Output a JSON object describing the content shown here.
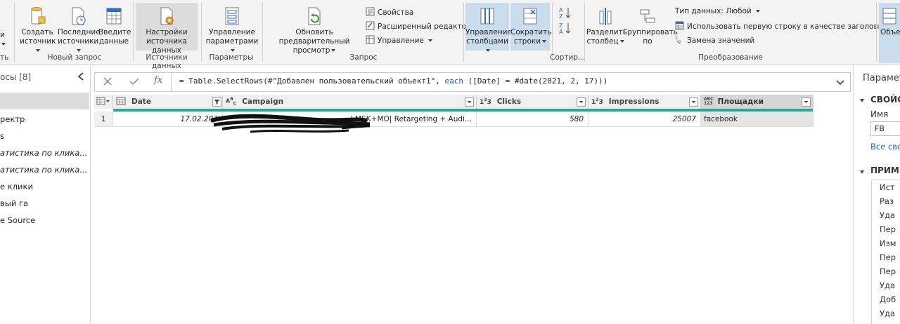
{
  "ribbon": {
    "groups": {
      "new_query": "Новый запрос",
      "data_sources": "Источники данных",
      "parameters": "Параметры",
      "query": "Запрос",
      "sort": "Сортир...",
      "transform": "Преобразование",
      "cut_left": "ть"
    },
    "buttons": {
      "cut_left_1": "и",
      "create_source_1": "Создать",
      "create_source_2": "источник",
      "recent_sources_1": "Последние",
      "recent_sources_2": "источники",
      "enter_data_1": "Введите",
      "enter_data_2": "данные",
      "ds_settings_1": "Настройки",
      "ds_settings_2": "источника данных",
      "manage_params_1": "Управление",
      "manage_params_2": "параметрами",
      "refresh_preview_1": "Обновить предварительный",
      "refresh_preview_2": "просмотр",
      "properties": "Свойства",
      "advanced_editor": "Расширенный редактор",
      "manage": "Управление",
      "manage_columns_1": "Управление",
      "manage_columns_2": "столбцами",
      "reduce_rows_1": "Сократить",
      "reduce_rows_2": "строки",
      "split_column_1": "Разделить",
      "split_column_2": "столбец",
      "group_by_1": "Группировать",
      "group_by_2": "по",
      "data_type": "Тип данных: Любой",
      "use_first_row": "Использовать первую строку в качестве заголовков",
      "replace_values": "Замена значений",
      "combine_1": "Объед"
    }
  },
  "left_pane": {
    "title": "осы [8]",
    "items": [
      "ректр",
      "s",
      "атистика по клика...",
      "атистика по клика...",
      "е клики",
      "вый га",
      "e Source"
    ]
  },
  "formula_bar": {
    "formula_prefix": "= Table.SelectRows(#\"Добавлен пользовательский объект1\", ",
    "formula_keyword": "each",
    "formula_suffix": " ([Date] = #date(2021, 2, 17)))",
    "fx": "fx"
  },
  "grid": {
    "columns": [
      {
        "name": "Date",
        "type_icon": "calendar"
      },
      {
        "name": "Campaign",
        "type_icon": "ABC"
      },
      {
        "name": "Clicks",
        "type_icon": "123"
      },
      {
        "name": "Impressions",
        "type_icon": "123"
      },
      {
        "name": "Площадки",
        "type_icon": "ABC123"
      }
    ],
    "rows": [
      {
        "index": "1",
        "date": "17.02.202",
        "campaign": "| MSK+MO| Retargeting + Audi...",
        "clicks": "580",
        "impressions": "25007",
        "ploshadki": "facebook"
      }
    ]
  },
  "right_pane": {
    "title": "Параметр",
    "properties_heading": "СВОЙС",
    "name_label": "Имя",
    "name_value": "FB",
    "all_properties": "Все свой",
    "applied_steps_heading": "ПРИМЕ",
    "steps": [
      "Ист",
      "Раз",
      "Уда",
      "Пер",
      "Изм",
      "Пер",
      "Пер",
      "Уда",
      "Доб",
      "Уда"
    ]
  },
  "colors": {
    "accent_teal": "#2aa79d",
    "link_blue": "#1a66b8",
    "selected_blue": "#cbdced",
    "selected_gray": "#dcdcdc"
  }
}
